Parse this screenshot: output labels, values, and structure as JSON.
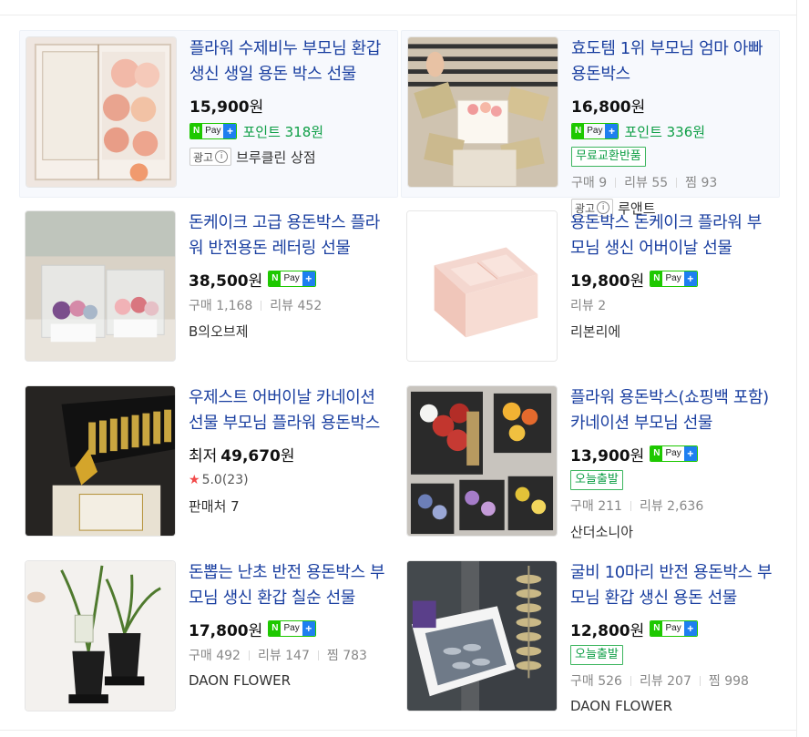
{
  "products": [
    {
      "title": "플라워 수제비누 부모님 환갑 생신 생일 용돈 박스 선물",
      "price": "15,900",
      "won": "원",
      "point": "포인트 318원",
      "ad_label": "광고",
      "seller": "브루클린 상점",
      "image": "flower-soap-gift-box"
    },
    {
      "title": "효도템 1위 부모님 엄마 아빠 용돈박스",
      "price": "16,800",
      "won": "원",
      "point": "포인트 336원",
      "tag": "무료교환반품",
      "stats": [
        "구매 9",
        "리뷰 55",
        "찜 93"
      ],
      "ad_label": "광고",
      "seller": "루앤트",
      "image": "money-cake-box-hands"
    },
    {
      "title": "돈케이크 고급 용돈박스 플라워 반전용돈 레터링 선물",
      "price": "38,500",
      "won": "원",
      "stats": [
        "구매 1,168",
        "리뷰 452"
      ],
      "seller": "B의오브제",
      "image": "clear-flower-boxes"
    },
    {
      "title": "용돈박스 돈케이크 플라워 부모님 생신 어버이날 선물",
      "price": "19,800",
      "won": "원",
      "stats": [
        "리뷰 2"
      ],
      "seller": "리본리에",
      "image": "pink-box"
    },
    {
      "title": "우제스트 어버이날 카네이션 선물 부모님 플라워 용돈박스",
      "low_label": "최저",
      "price": "49,670",
      "won": "원",
      "rating": "5.0(23)",
      "seller": "판매처 7",
      "image": "gold-money-box"
    },
    {
      "title": "플라워 용돈박스(쇼핑백 포함) 카네이션 부모님 선물",
      "price": "13,900",
      "won": "원",
      "tag": "오늘출발",
      "stats": [
        "구매 211",
        "리뷰 2,636"
      ],
      "seller": "산더소니아",
      "image": "flower-box-grid"
    },
    {
      "title": "돈뽑는 난초 반전 용돈박스 부모님 생신 환갑 칠순 선물",
      "price": "17,800",
      "won": "원",
      "stats": [
        "구매 492",
        "리뷰 147",
        "찜 783"
      ],
      "seller": "DAON FLOWER",
      "image": "orchid-pots"
    },
    {
      "title": "굴비 10마리 반전 용돈박스 부모님 환갑 생신 용돈 선물",
      "price": "12,800",
      "won": "원",
      "tag": "오늘출발",
      "stats": [
        "구매 526",
        "리뷰 207",
        "찜 998"
      ],
      "seller": "DAON FLOWER",
      "image": "fish-money-box"
    }
  ],
  "npay": {
    "n": "N",
    "pay": "Pay",
    "plus": "+"
  },
  "ad_info_icon": "i",
  "colors": {
    "title": "#1a3fa0",
    "point": "#0d9e45",
    "npay_green": "#1ec800",
    "npay_blue": "#1e7ff0",
    "star": "#f24a4a"
  }
}
